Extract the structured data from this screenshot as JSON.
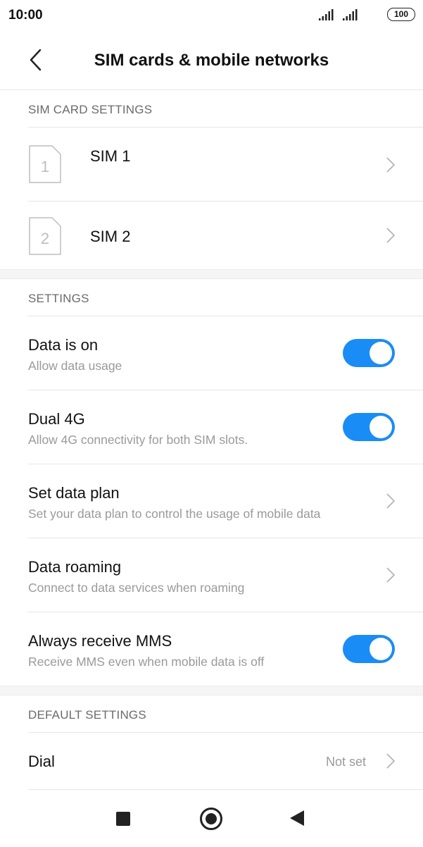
{
  "status_bar": {
    "time": "10:00",
    "battery": "100",
    "icons": [
      "signal-icon",
      "signal-icon",
      "battery-icon"
    ]
  },
  "header": {
    "title": "SIM cards & mobile networks",
    "back_icon": "chevron-left-icon"
  },
  "sim_section": {
    "header": "SIM CARD SETTINGS",
    "items": [
      {
        "number": "1",
        "label": "SIM 1"
      },
      {
        "number": "2",
        "label": "SIM 2"
      }
    ]
  },
  "settings_section": {
    "header": "SETTINGS",
    "items": [
      {
        "title": "Data is on",
        "subtitle": "Allow data usage",
        "control": "toggle",
        "on": true
      },
      {
        "title": "Dual 4G",
        "subtitle": "Allow 4G connectivity for both SIM slots.",
        "control": "toggle",
        "on": true
      },
      {
        "title": "Set data plan",
        "subtitle": "Set your data plan to control the usage of mobile data",
        "control": "chevron"
      },
      {
        "title": "Data roaming",
        "subtitle": "Connect to data services when roaming",
        "control": "chevron"
      },
      {
        "title": "Always receive MMS",
        "subtitle": "Receive MMS even when mobile data is off",
        "control": "toggle",
        "on": true
      }
    ]
  },
  "default_section": {
    "header": "DEFAULT SETTINGS",
    "items": [
      {
        "title": "Dial",
        "value": "Not set"
      }
    ]
  },
  "nav_bar": {
    "icons": [
      "recents-square-icon",
      "home-circle-icon",
      "back-triangle-icon"
    ]
  },
  "colors": {
    "toggle_on": "#1a8cf5",
    "section_gap": "#f5f5f5",
    "secondary_text": "#9a9a9a",
    "section_header_text": "#6b6b6b"
  }
}
